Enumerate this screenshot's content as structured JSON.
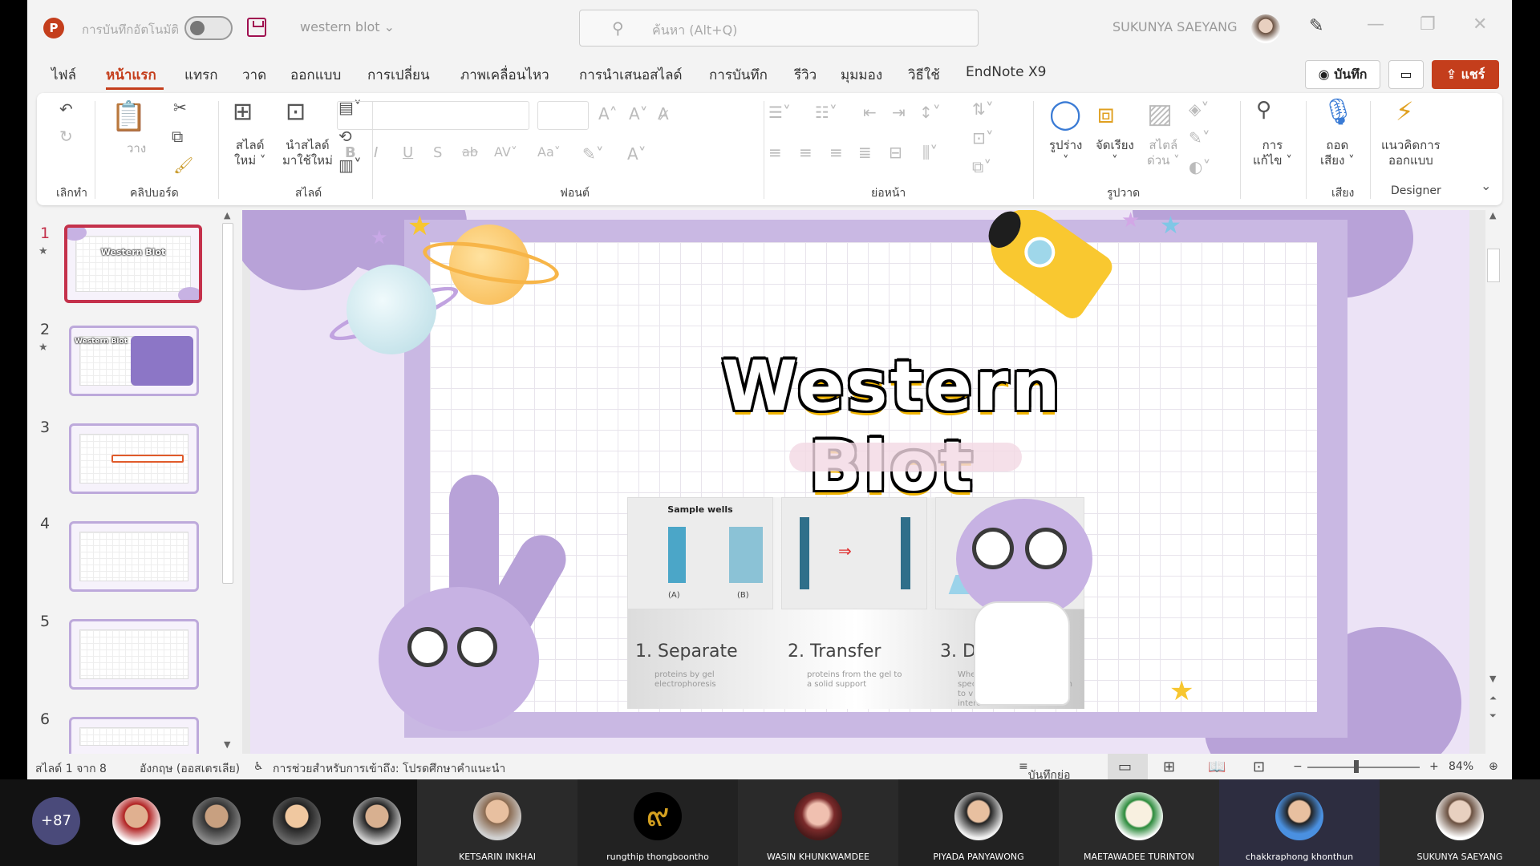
{
  "titlebar": {
    "app_logo": "P",
    "autosave_label": "การบันทึกอัตโนมัติ",
    "filename": "western blot",
    "search_placeholder": "ค้นหา (Alt+Q)",
    "user_name": "SUKUNYA SAEYANG"
  },
  "menu": {
    "tabs": [
      "ไฟล์",
      "หน้าแรก",
      "แทรก",
      "วาด",
      "ออกแบบ",
      "การเปลี่ยน",
      "ภาพเคลื่อนไหว",
      "การนำเสนอสไลด์",
      "การบันทึก",
      "รีวิว",
      "มุมมอง",
      "วิธีใช้",
      "EndNote X9"
    ],
    "record_label": "บันทึก",
    "share_label": "แชร์"
  },
  "ribbon": {
    "groups": {
      "undo": "เลิกทำ",
      "clipboard": "คลิปบอร์ด",
      "slides": "สไลด์",
      "font": "ฟอนต์",
      "paragraph": "ย่อหน้า",
      "drawing": "รูปวาด",
      "voice": "เสียง",
      "designer": "Designer"
    },
    "buttons": {
      "paste": "วาง",
      "new_slide_1": "สไลด์",
      "new_slide_2": "ใหม่ ˅",
      "reuse_1": "นำสไลด์",
      "reuse_2": "มาใช้ใหม่",
      "shapes": "รูปร่าง",
      "arrange": "จัดเรียง",
      "quick_styles_1": "สไตล์",
      "quick_styles_2": "ด่วน ˅",
      "editing_1": "การ",
      "editing_2": "แก้ไข ˅",
      "dictate_1": "ถอด",
      "dictate_2": "เสียง ˅",
      "designer_1": "แนวคิดการ",
      "designer_2": "ออกแบบ"
    }
  },
  "thumbnails": {
    "numbers": [
      "1",
      "2",
      "3",
      "4",
      "5",
      "6"
    ],
    "slide1_title": "Western Blot",
    "slide2_title": "Western Blot"
  },
  "slide": {
    "title": "Western Blot",
    "panel": {
      "img1_caption": "Sample wells",
      "img1_a": "(A)",
      "img1_b": "(B)",
      "steps": [
        {
          "label": "1. Separate",
          "sub": "proteins by gel electrophoresis"
        },
        {
          "label": "2. Transfer",
          "sub": "proteins from the gel to a solid support"
        },
        {
          "label": "3. Detect",
          "sub": "Where we use antibodies specific to the target protein to visualize the protein of interest."
        }
      ]
    }
  },
  "status": {
    "slide_info": "สไลด์ 1 จาก 8",
    "language": "อังกฤษ (ออสเตรเลีย)",
    "accessibility": "การช่วยสำหรับการเข้าถึง: โปรดศึกษาคำแนะนำ",
    "notes": "บันทึกย่อ",
    "zoom": "84%"
  },
  "meeting": {
    "more_count": "+87",
    "participants": [
      "KETSARIN INKHAI",
      "rungthip thongboontho",
      "WASIN KHUNKWAMDEE",
      "PIYADA PANYAWONG",
      "MAETAWADEE TURINTON",
      "chakkraphong khonthun",
      "SUKUNYA SAEYANG"
    ]
  },
  "colors": {
    "accent": "#c43e1c",
    "slide_purple": "#b8a2d8",
    "selected_thumb": "#c4314b"
  }
}
